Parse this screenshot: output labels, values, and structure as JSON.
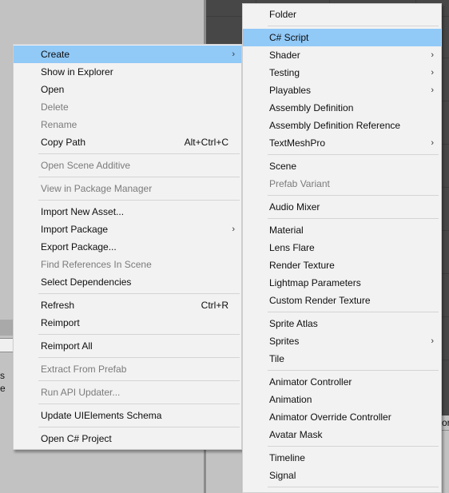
{
  "main_menu": {
    "items": [
      {
        "label": "Create",
        "has_submenu": true,
        "highlighted": true
      },
      {
        "label": "Show in Explorer"
      },
      {
        "label": "Open"
      },
      {
        "label": "Delete",
        "disabled": true
      },
      {
        "label": "Rename",
        "disabled": true
      },
      {
        "label": "Copy Path",
        "shortcut": "Alt+Ctrl+C"
      },
      {
        "separator": true
      },
      {
        "label": "Open Scene Additive",
        "disabled": true
      },
      {
        "separator": true
      },
      {
        "label": "View in Package Manager",
        "disabled": true
      },
      {
        "separator": true
      },
      {
        "label": "Import New Asset..."
      },
      {
        "label": "Import Package",
        "has_submenu": true
      },
      {
        "label": "Export Package..."
      },
      {
        "label": "Find References In Scene",
        "disabled": true
      },
      {
        "label": "Select Dependencies"
      },
      {
        "separator": true
      },
      {
        "label": "Refresh",
        "shortcut": "Ctrl+R"
      },
      {
        "label": "Reimport"
      },
      {
        "separator": true
      },
      {
        "label": "Reimport All"
      },
      {
        "separator": true
      },
      {
        "label": "Extract From Prefab",
        "disabled": true
      },
      {
        "separator": true
      },
      {
        "label": "Run API Updater...",
        "disabled": true
      },
      {
        "separator": true
      },
      {
        "label": "Update UIElements Schema"
      },
      {
        "separator": true
      },
      {
        "label": "Open C# Project"
      }
    ]
  },
  "create_submenu": {
    "items": [
      {
        "label": "Folder"
      },
      {
        "separator": true
      },
      {
        "label": "C# Script",
        "highlighted": true
      },
      {
        "label": "Shader",
        "has_submenu": true
      },
      {
        "label": "Testing",
        "has_submenu": true
      },
      {
        "label": "Playables",
        "has_submenu": true
      },
      {
        "label": "Assembly Definition"
      },
      {
        "label": "Assembly Definition Reference"
      },
      {
        "label": "TextMeshPro",
        "has_submenu": true
      },
      {
        "separator": true
      },
      {
        "label": "Scene"
      },
      {
        "label": "Prefab Variant",
        "disabled": true
      },
      {
        "separator": true
      },
      {
        "label": "Audio Mixer"
      },
      {
        "separator": true
      },
      {
        "label": "Material"
      },
      {
        "label": "Lens Flare"
      },
      {
        "label": "Render Texture"
      },
      {
        "label": "Lightmap Parameters"
      },
      {
        "label": "Custom Render Texture"
      },
      {
        "separator": true
      },
      {
        "label": "Sprite Atlas"
      },
      {
        "label": "Sprites",
        "has_submenu": true
      },
      {
        "label": "Tile"
      },
      {
        "separator": true
      },
      {
        "label": "Animator Controller"
      },
      {
        "label": "Animation"
      },
      {
        "label": "Animator Override Controller"
      },
      {
        "label": "Avatar Mask"
      },
      {
        "separator": true
      },
      {
        "label": "Timeline"
      },
      {
        "label": "Signal"
      },
      {
        "separator": true
      }
    ]
  },
  "background": {
    "left_fragments": [
      "s",
      "e"
    ],
    "right_fragment": "or"
  },
  "icons": {
    "submenu_arrow": "›"
  },
  "colors": {
    "highlight": "#91c9f7",
    "menu_bg": "#f2f2f2",
    "disabled_text": "#7b7b7b",
    "scene_bg": "#474747",
    "panel_bg": "#c2c2c2"
  }
}
